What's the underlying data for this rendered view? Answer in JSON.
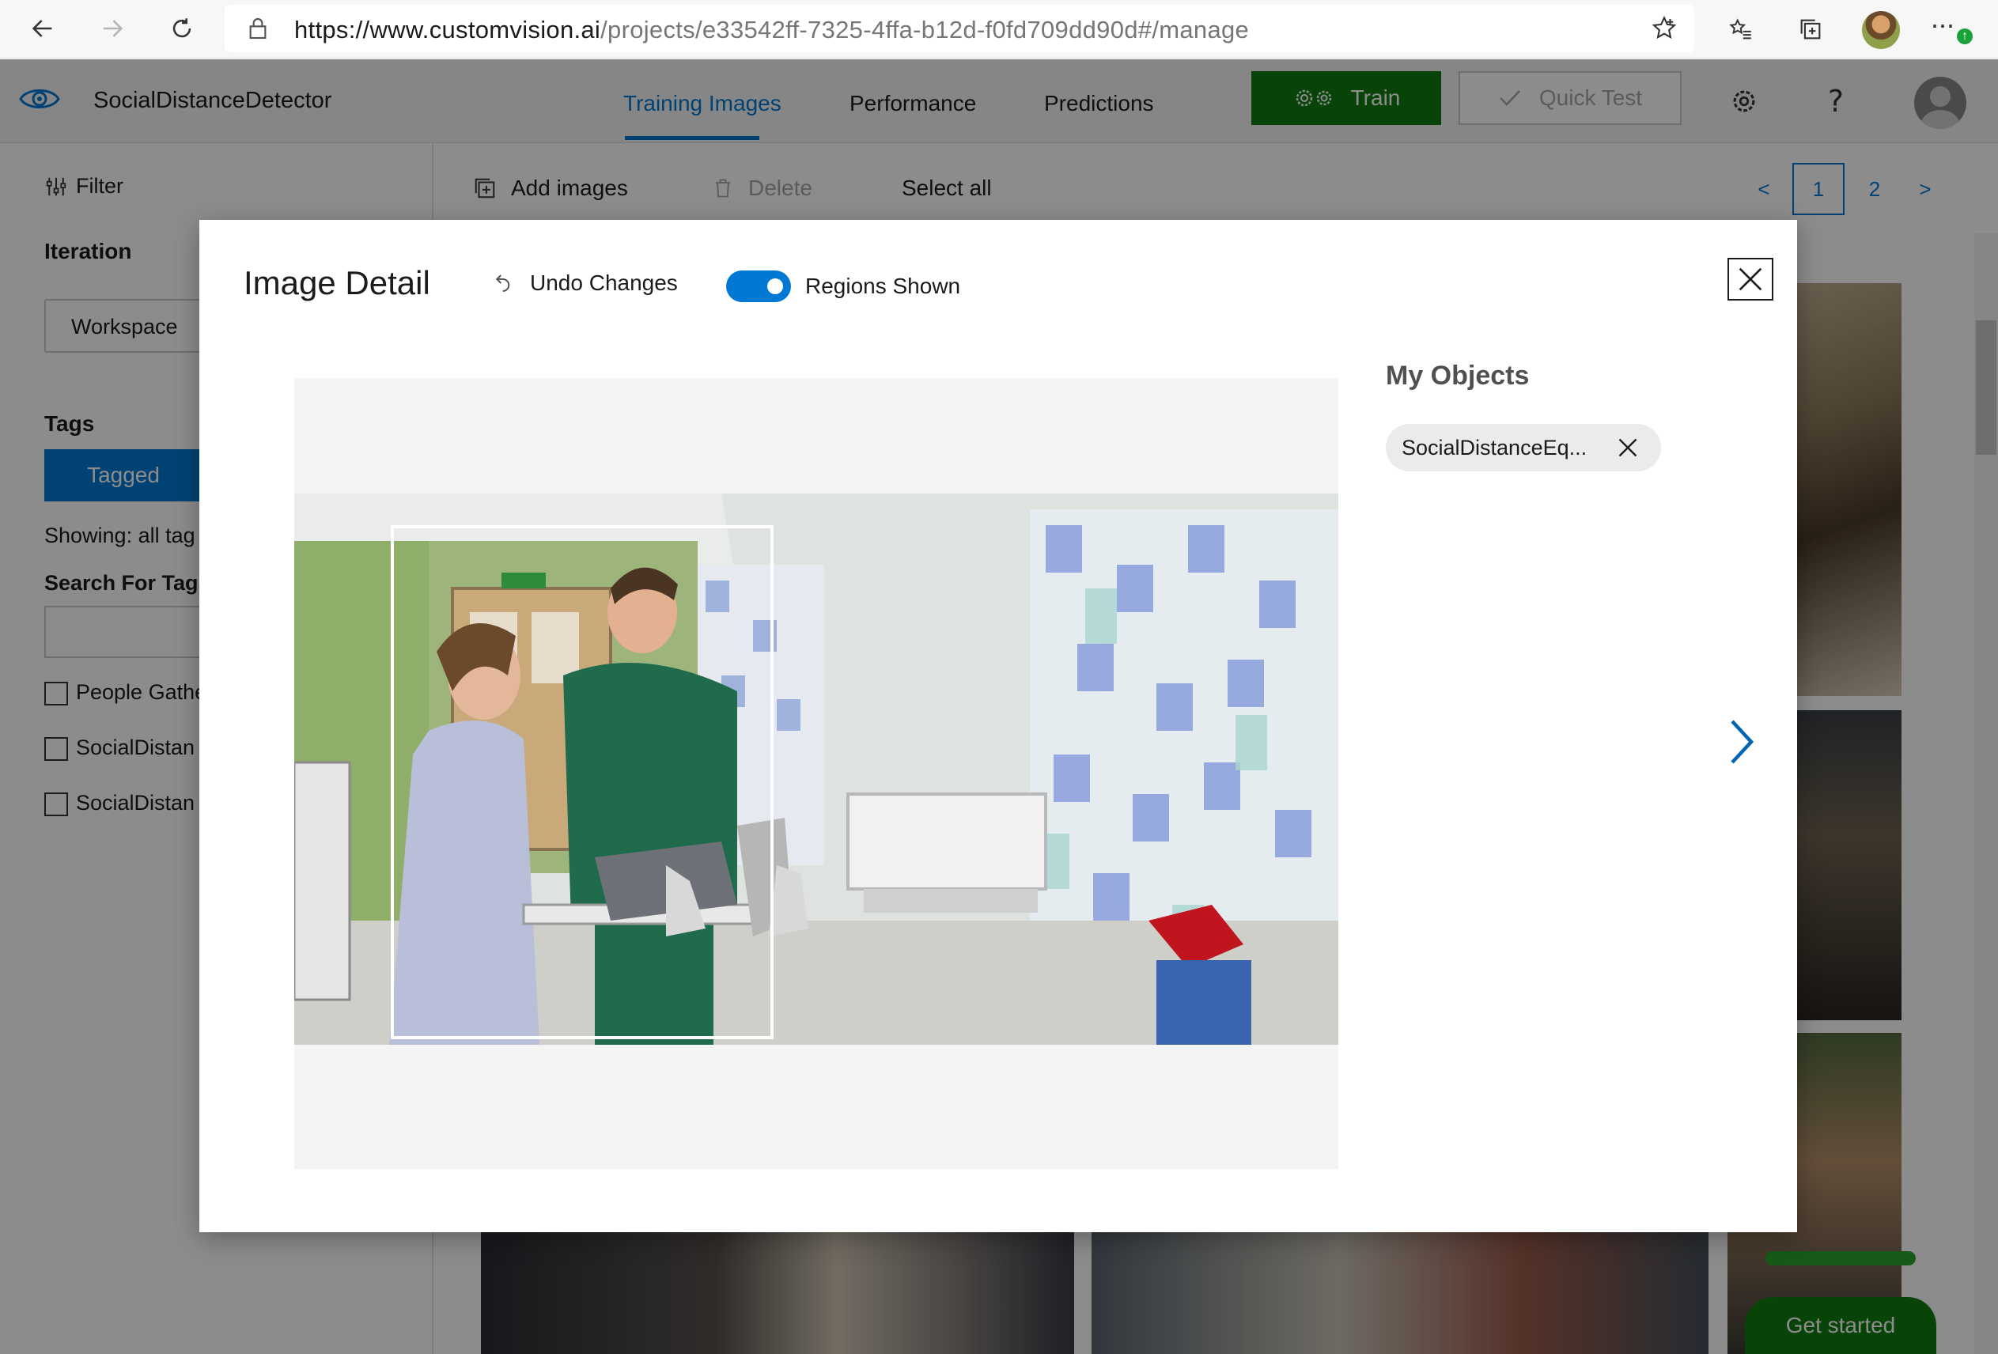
{
  "browser": {
    "url_scheme_host": "https://www.customvision.ai",
    "url_path": "/projects/e33542ff-7325-4ffa-b12d-f0fd709dd90d#/manage",
    "update_badge": "↑"
  },
  "app": {
    "project_name": "SocialDistanceDetector",
    "tabs": [
      {
        "label": "Training Images",
        "active": true
      },
      {
        "label": "Performance",
        "active": false
      },
      {
        "label": "Predictions",
        "active": false
      }
    ],
    "train_label": "Train",
    "quick_test_label": "Quick Test",
    "help_label": "?"
  },
  "sidebar": {
    "filter_label": "Filter",
    "iteration_heading": "Iteration",
    "iteration_value": "Workspace",
    "tags_heading": "Tags",
    "tagged_label": "Tagged",
    "showing_text": "Showing: all tag",
    "search_tags_label": "Search For Tags",
    "tag_items": [
      "People Gathe",
      "SocialDistan",
      "SocialDistan"
    ]
  },
  "toolbar": {
    "add_images_label": "Add images",
    "delete_label": "Delete",
    "select_all_label": "Select all",
    "pager": {
      "prev": "<",
      "pages": [
        "1",
        "2"
      ],
      "current": "1",
      "next": ">"
    }
  },
  "get_started_label": "Get started",
  "modal": {
    "title": "Image Detail",
    "undo_label": "Undo Changes",
    "regions_toggle_label": "Regions Shown",
    "regions_shown": true,
    "objects_heading": "My Objects",
    "object_tags": [
      "SocialDistanceEq..."
    ]
  },
  "colors": {
    "accent": "#0078d4",
    "train_green": "#107c10"
  }
}
